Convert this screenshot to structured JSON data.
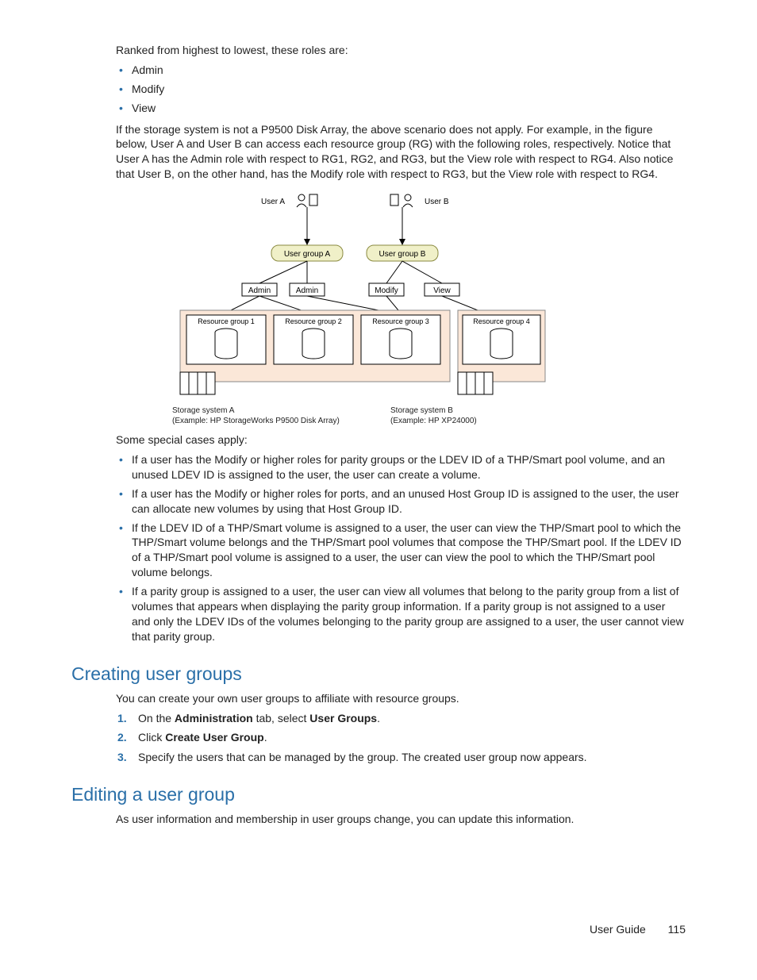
{
  "intro": "Ranked from highest to lowest, these roles are:",
  "roles": [
    "Admin",
    "Modify",
    "View"
  ],
  "para1": "If the storage system is not a P9500 Disk Array, the above scenario does not apply. For example, in the figure below, User A and User B can access each resource group (RG) with the following roles, respectively. Notice that User A has the Admin role with respect to RG1, RG2, and RG3, but the View role with respect to RG4. Also notice that User B, on the other hand, has the Modify role with respect to RG3, but the View role with respect to RG4.",
  "diagram": {
    "userA": "User A",
    "userB": "User B",
    "ugA": "User group A",
    "ugB": "User group B",
    "admin": "Admin",
    "modify": "Modify",
    "view": "View",
    "rg1": "Resource group 1",
    "rg2": "Resource group 2",
    "rg3": "Resource group 3",
    "rg4": "Resource group 4",
    "capA1": "Storage system A",
    "capA2": "(Example: HP StorageWorks P9500 Disk Array)",
    "capB1": "Storage system B",
    "capB2": "(Example: HP XP24000)"
  },
  "special_intro": "Some special cases apply:",
  "special": [
    "If a user has the Modify or higher roles for parity groups or the LDEV ID of a THP/Smart pool volume, and an unused LDEV ID is assigned to the user, the user can create a volume.",
    "If a user has the Modify or higher roles for ports, and an unused Host Group ID is assigned to the user, the user can allocate new volumes by using that Host Group ID.",
    "If the LDEV ID of a THP/Smart volume is assigned to a user, the user can view the THP/Smart pool to which the THP/Smart volume belongs and the THP/Smart pool volumes that compose the THP/Smart pool. If the LDEV ID of a THP/Smart pool volume is assigned to a user, the user can view the pool to which the THP/Smart pool volume belongs.",
    "If a parity group is assigned to a user, the user can view all volumes that belong to the parity group from a list of volumes that appears when displaying the parity group information. If a parity group is not assigned to a user and only the LDEV IDs of the volumes belonging to the parity group are assigned to a user, the user cannot view that parity group."
  ],
  "sec1_title": "Creating user groups",
  "sec1_intro": "You can create your own user groups to affiliate with resource groups.",
  "steps": {
    "s1a": "On the ",
    "s1b": "Administration",
    "s1c": " tab, select ",
    "s1d": "User Groups",
    "s1e": ".",
    "s2a": "Click ",
    "s2b": "Create User Group",
    "s2c": ".",
    "s3": "Specify the users that can be managed by the group. The created user group now appears."
  },
  "sec2_title": "Editing a user group",
  "sec2_intro": "As user information and membership in user groups change, you can update this information.",
  "footer_label": "User Guide",
  "footer_page": "115"
}
